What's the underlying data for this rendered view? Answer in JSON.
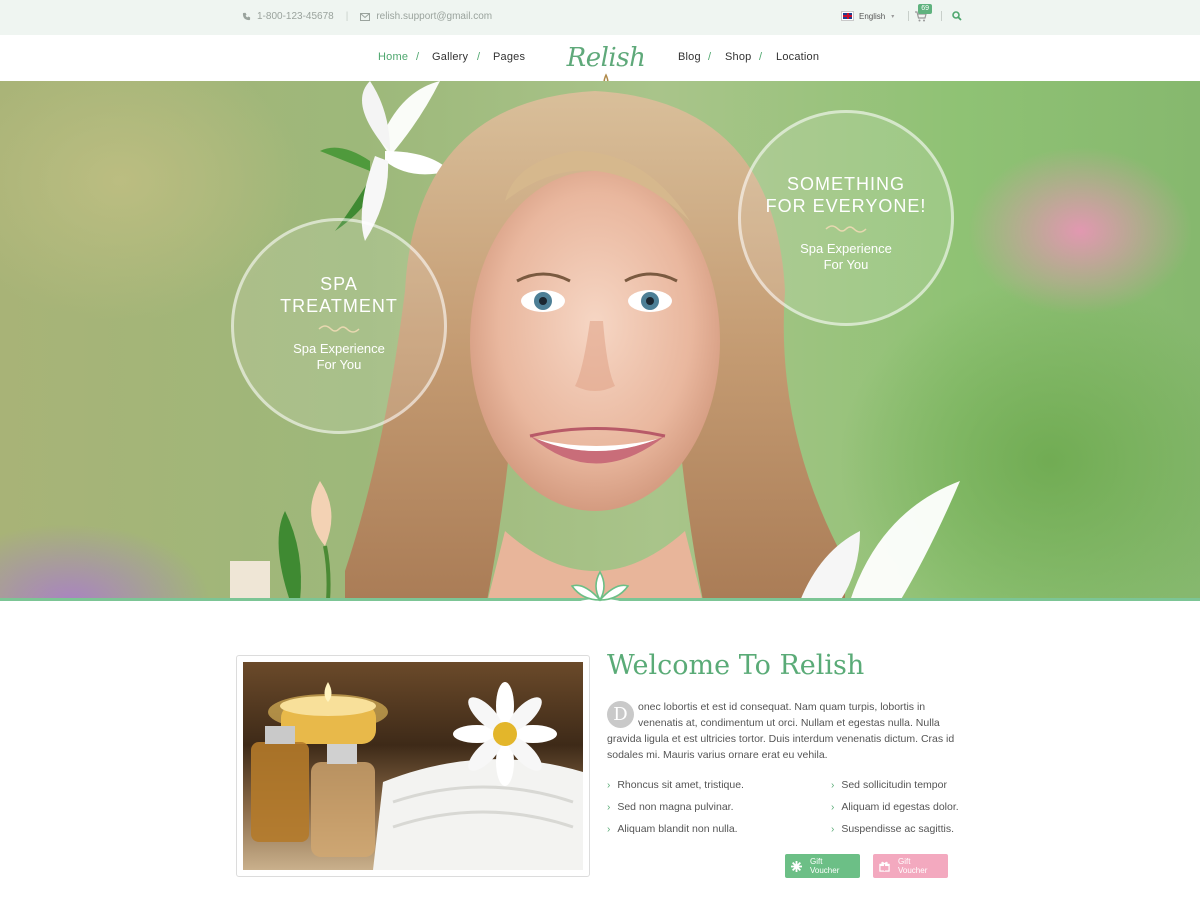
{
  "topbar": {
    "phone": "1-800-123-45678",
    "email": "relish.support@gmail.com",
    "language": "English",
    "cart_count": "69"
  },
  "nav": {
    "items_left": [
      "Home",
      "Gallery",
      "Pages"
    ],
    "items_right": [
      "Blog",
      "Shop",
      "Location"
    ],
    "active": "Home",
    "logo": "Relish"
  },
  "hero": {
    "circle_left": {
      "title_line1": "SPA",
      "title_line2": "TREATMENT",
      "sub_line1": "Spa Experience",
      "sub_line2": "For You"
    },
    "circle_right": {
      "title_line1": "SOMETHING",
      "title_line2": "FOR EVERYONE!",
      "sub_line1": "Spa Experience",
      "sub_line2": "For You"
    }
  },
  "welcome": {
    "title": "Welcome To Relish",
    "dropcap": "D",
    "paragraph": "onec lobortis et est id consequat. Nam quam turpis, lobortis in venenatis at, condimentum ut orci. Nullam et egestas nulla. Nulla gravida ligula et est ultricies tortor. Duis interdum venenatis dictum. Cras id sodales mi. Mauris varius ornare erat eu vehila.",
    "list_left": [
      "Rhoncus sit amet, tristique.",
      "Sed non magna pulvinar.",
      "Aliquam blandit non nulla."
    ],
    "list_right": [
      "Sed sollicitudin tempor",
      "Aliquam id egestas dolor.",
      "Suspendisse ac sagittis."
    ],
    "btn_green": {
      "line1": "Gift",
      "line2": "Voucher"
    },
    "btn_pink": {
      "line1": "Gift",
      "line2": "Voucher"
    }
  },
  "colors": {
    "accent": "#5aab77",
    "pink": "#f3a9bf",
    "topbar_bg": "#eff5f1"
  }
}
